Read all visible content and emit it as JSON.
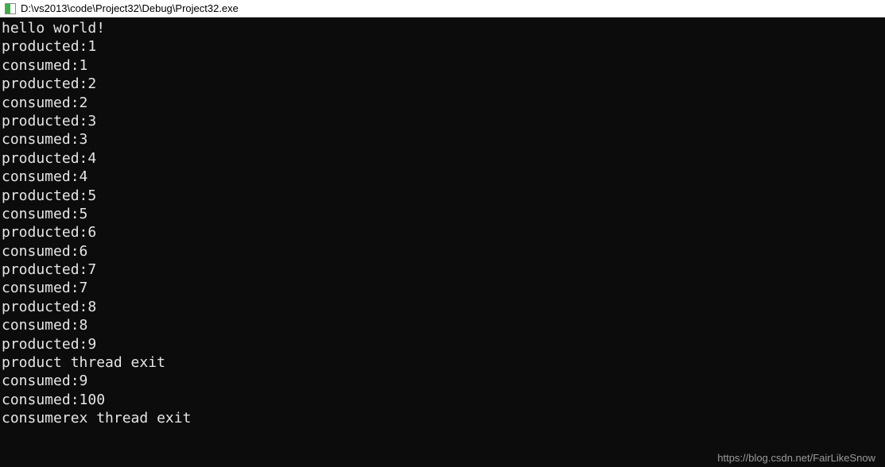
{
  "window": {
    "title": "D:\\vs2013\\code\\Project32\\Debug\\Project32.exe"
  },
  "console": {
    "lines": [
      "hello world!",
      "producted:1",
      "consumed:1",
      "producted:2",
      "consumed:2",
      "producted:3",
      "consumed:3",
      "producted:4",
      "consumed:4",
      "producted:5",
      "consumed:5",
      "producted:6",
      "consumed:6",
      "producted:7",
      "consumed:7",
      "producted:8",
      "consumed:8",
      "producted:9",
      "product thread exit",
      "consumed:9",
      "consumed:100",
      "consumerex thread exit"
    ]
  },
  "watermark": {
    "text": "https://blog.csdn.net/FairLikeSnow"
  }
}
